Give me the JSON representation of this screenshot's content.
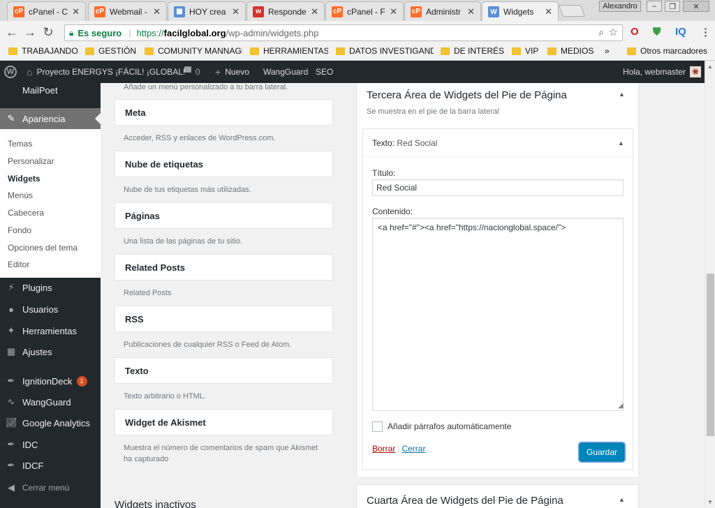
{
  "tabs": [
    {
      "title": "cPanel - C",
      "icon": "cpanel-icon"
    },
    {
      "title": "Webmail -",
      "icon": "cpanel-icon"
    },
    {
      "title": "HOY crea",
      "icon": "page-icon"
    },
    {
      "title": "Responde",
      "icon": "w-icon"
    },
    {
      "title": "cPanel - F",
      "icon": "cpanel-icon"
    },
    {
      "title": "Administr",
      "icon": "cpanel-icon"
    },
    {
      "title": "Widgets",
      "icon": "wordpress-icon"
    }
  ],
  "window": {
    "user": "Alexandro"
  },
  "omnibox": {
    "secure_label": "Es seguro",
    "url_protocol": "https://",
    "url_domain": "facilglobal.org",
    "url_path": "/wp-admin/widgets.php"
  },
  "bookmarks": [
    "TRABAJANDO",
    "GESTIÓN",
    "COMUNITY MANNAGE",
    "HERRAMIENTAS",
    "DATOS INVESTIGANDO",
    "DE INTERÉS",
    "VIP",
    "MEDIOS"
  ],
  "bookmarks_more": "»",
  "other_bookmarks": "Otros marcadores",
  "adminbar": {
    "site": "Proyecto ENERGYS ¡FÁCIL! ¡GLOBAL!",
    "comments": "0",
    "new": "Nuevo",
    "wangguard": "WangGuard",
    "seo": "SEO",
    "greeting": "Hola, webmaster"
  },
  "sidebar": {
    "mailpoet": "MailPoet",
    "apariencia": "Apariencia",
    "submenu": [
      "Temas",
      "Personalizar",
      "Widgets",
      "Menús",
      "Cabecera",
      "Fondo",
      "Opciones del tema",
      "Editor"
    ],
    "items": [
      {
        "label": "Plugins",
        "icon": "plugins-icon"
      },
      {
        "label": "Usuarios",
        "icon": "users-icon"
      },
      {
        "label": "Herramientas",
        "icon": "tools-icon"
      },
      {
        "label": "Ajustes",
        "icon": "settings-icon"
      },
      {
        "label": "IgnitionDeck",
        "icon": "feather-icon",
        "badge": "1"
      },
      {
        "label": "WangGuard",
        "icon": "wangguard-icon"
      },
      {
        "label": "Google Analytics",
        "icon": "analytics-icon"
      },
      {
        "label": "IDC",
        "icon": "feather-icon"
      },
      {
        "label": "IDCF",
        "icon": "feather-icon"
      }
    ],
    "collapse": "Cerrar menú"
  },
  "widgets": {
    "top_desc": "Añade un menú personalizado a tu barra lateral.",
    "list": [
      {
        "title": "Meta",
        "desc": "Acceder, RSS y enlaces de WordPress.com."
      },
      {
        "title": "Nube de etiquetas",
        "desc": "Nube de tus etiquetas más utilizadas."
      },
      {
        "title": "Páginas",
        "desc": "Una lista de las páginas de tu sitio."
      },
      {
        "title": "Related Posts",
        "desc": "Related Posts"
      },
      {
        "title": "RSS",
        "desc": "Publicaciones de cualquier RSS o Feed de Atom."
      },
      {
        "title": "Texto",
        "desc": "Texto arbitrario o HTML."
      },
      {
        "title": "Widget de Akismet",
        "desc": "Muestra el número de comentarios de spam que Akismet ha capturado"
      }
    ],
    "inactive_heading": "Widgets inactivos"
  },
  "area3": {
    "title": "Tercera Área de Widgets del Pie de Página",
    "desc": "Se muestra en el pie de la barra lateral",
    "widget_type": "Texto:",
    "widget_name": "Red Social",
    "title_label": "Título:",
    "title_value": "Red Social",
    "content_label": "Contenido:",
    "content_value": "<a href=\"#\"><a href=\"https://nacionglobal.space/\">",
    "autop_label": "Añadir párrafos automáticamente",
    "delete": "Borrar",
    "divider": "|",
    "close": "Cerrar",
    "save": "Guardar"
  },
  "area4": {
    "title": "Cuarta Área de Widgets del Pie de Página"
  }
}
